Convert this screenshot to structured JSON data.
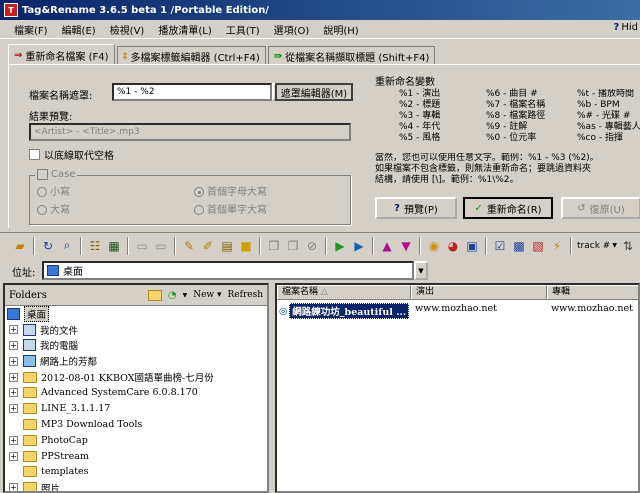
{
  "window": {
    "title": "Tag&Rename 3.6.5 beta 1 /Portable Edition/"
  },
  "menu": [
    "檔案(F)",
    "編輯(E)",
    "檢視(V)",
    "播放清單(L)",
    "工具(T)",
    "選項(O)",
    "說明(H)"
  ],
  "menu_right": {
    "hide_label": "Hid"
  },
  "tabs": [
    {
      "label": "重新命名檔案 (F4)",
      "icon": "rename-icon"
    },
    {
      "label": "多檔案標籤編輯器 (Ctrl+F4)",
      "icon": "multi-tag-icon"
    },
    {
      "label": "從檔案名稱擷取標題 (Shift+F4)",
      "icon": "extract-icon"
    }
  ],
  "rename": {
    "mask_label": "檔案名稱遮罩:",
    "mask_value": "%1 - %2",
    "mask_editor_button": "遮罩編輯器(M)",
    "preview_label": "結果預覽:",
    "preview_value": "<Artist> - <Title>.mp3",
    "underscore_label": "以底線取代空格",
    "case_label": "Case",
    "case_options": [
      {
        "label": "小寫",
        "selected": false
      },
      {
        "label": "首個字母大寫",
        "selected": true
      },
      {
        "label": "大寫",
        "selected": false
      },
      {
        "label": "首個單字大寫",
        "selected": false
      }
    ]
  },
  "variables": {
    "title": "重新命名變數",
    "col1": [
      "%1 - 演出",
      "%2 - 標題",
      "%3 - 專輯",
      "%4 - 年代",
      "%5 - 風格"
    ],
    "col2": [
      "%6 - 曲目 #",
      "%7 - 檔案名稱",
      "%8 - 檔案路徑",
      "%9 - 註解",
      "%0 - 位元率"
    ],
    "col3": [
      "%t - 播放時間",
      "%b - BPM",
      "%# - 光碟 #",
      "%as - 專輯藝人",
      "%co - 指揮"
    ]
  },
  "hint": {
    "line1": "當然，您也可以使用任意文字。範例：%1 - %3 (%2)。",
    "line2": "如果檔案不包含標籤，則無法重新命名；要跳過資料夾",
    "line3": "結構，請使用 [\\]。範例：%1\\%2。"
  },
  "actions": {
    "preview": "預覽(P)",
    "rename": "重新命名(R)",
    "undo": "復原(U)"
  },
  "toolbar": {
    "track_label": "track #"
  },
  "address": {
    "label": "位址:",
    "value": "桌面"
  },
  "folders": {
    "header": "Folders",
    "new_label": "New",
    "refresh_label": "Refresh",
    "tree": [
      {
        "label": "桌面",
        "level": 0,
        "icon": "desktop-icon",
        "expander": false,
        "selected": true
      },
      {
        "label": "我的文件",
        "level": 1,
        "icon": "documents-icon",
        "expander": true
      },
      {
        "label": "我的電腦",
        "level": 1,
        "icon": "computer-icon",
        "expander": true
      },
      {
        "label": "網路上的芳鄰",
        "level": 1,
        "icon": "network-icon",
        "expander": true
      },
      {
        "label": "2012-08-01 KKBOX國語單曲榜-七月份",
        "level": 1,
        "icon": "folder-icon",
        "expander": true
      },
      {
        "label": "Advanced SystemCare 6.0.8.170",
        "level": 1,
        "icon": "folder-icon",
        "expander": true
      },
      {
        "label": "LINE_3.1.1.17",
        "level": 1,
        "icon": "folder-icon",
        "expander": true
      },
      {
        "label": "MP3 Download Tools",
        "level": 1,
        "icon": "folder-icon",
        "expander": false
      },
      {
        "label": "PhotoCap",
        "level": 1,
        "icon": "folder-icon",
        "expander": true
      },
      {
        "label": "PPStream",
        "level": 1,
        "icon": "folder-icon",
        "expander": true
      },
      {
        "label": "templates",
        "level": 1,
        "icon": "folder-icon",
        "expander": false
      },
      {
        "label": "照片",
        "level": 1,
        "icon": "folder-icon",
        "expander": true
      }
    ]
  },
  "filelist": {
    "columns": [
      "檔案名稱",
      "演出",
      "專輯"
    ],
    "rows": [
      {
        "filename": "網路練功坊_beautiful ...",
        "artist": "www.mozhao.net",
        "album": "www.mozhao.net"
      }
    ]
  },
  "colors": {
    "title_start": "#0a246a",
    "title_end": "#3a6ea5",
    "selection": "#0a246a"
  }
}
